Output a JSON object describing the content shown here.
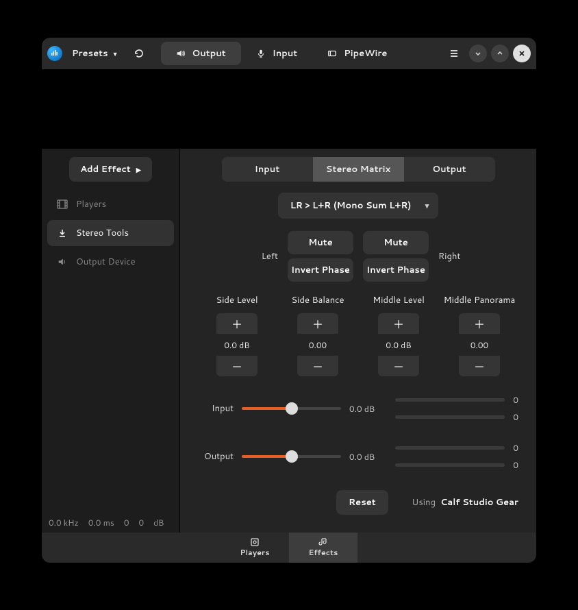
{
  "header": {
    "presets": "Presets",
    "tabs": {
      "output": "Output",
      "input": "Input",
      "pipewire": "PipeWire"
    }
  },
  "sidebar": {
    "add_effect": "Add Effect",
    "players": "Players",
    "stereo_tools": "Stereo Tools",
    "output_device": "Output Device",
    "footer": {
      "khz": "0.0 kHz",
      "ms": "0.0 ms",
      "val1": "0",
      "val2": "0",
      "db": "dB"
    }
  },
  "content": {
    "tabs": {
      "input": "Input",
      "matrix": "Stereo Matrix",
      "output": "Output"
    },
    "mode": "LR > L+R (Mono Sum L+R)",
    "left": "Left",
    "right": "Right",
    "mute": "Mute",
    "invert": "Invert Phase",
    "params": {
      "side_level": {
        "label": "Side Level",
        "value": "0.0 dB"
      },
      "side_balance": {
        "label": "Side Balance",
        "value": "0.00"
      },
      "middle_level": {
        "label": "Middle Level",
        "value": "0.0 dB"
      },
      "middle_panorama": {
        "label": "Middle Panorama",
        "value": "0.00"
      }
    },
    "input": {
      "label": "Input",
      "value": "0.0 dB",
      "meter1": "0",
      "meter2": "0"
    },
    "output": {
      "label": "Output",
      "value": "0.0 dB",
      "meter1": "0",
      "meter2": "0"
    },
    "reset": "Reset",
    "using": "Using",
    "vendor": "Calf Studio Gear"
  },
  "bottom": {
    "players": "Players",
    "effects": "Effects"
  }
}
